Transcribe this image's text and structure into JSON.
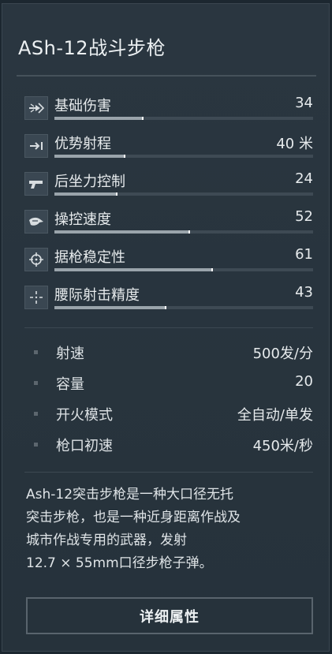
{
  "weapon": {
    "name": "ASh-12战斗步枪"
  },
  "stats": [
    {
      "label": "基础伤害",
      "value": "34",
      "level": 0.34,
      "icon": "damage-icon"
    },
    {
      "label": "优势射程",
      "value": "40 米",
      "level": 0.27,
      "icon": "range-arrow-icon"
    },
    {
      "label": "后坐力控制",
      "value": "24",
      "level": 0.24,
      "icon": "recoil-pistol-icon"
    },
    {
      "label": "操控速度",
      "value": "52",
      "level": 0.52,
      "icon": "handling-hand-icon"
    },
    {
      "label": "据枪稳定性",
      "value": "61",
      "level": 0.61,
      "icon": "stability-crosshair-icon"
    },
    {
      "label": "腰际射击精度",
      "value": "43",
      "level": 0.43,
      "icon": "hipfire-crosshair-icon"
    }
  ],
  "specs": [
    {
      "label": "射速",
      "value": "500发/分"
    },
    {
      "label": "容量",
      "value": "20"
    },
    {
      "label": "开火模式",
      "value": "全自动/单发"
    },
    {
      "label": "枪口初速",
      "value": "450米/秒"
    }
  ],
  "description": {
    "lines": [
      "Ash-12突击步枪是一种大口径无托",
      "突击步枪，也是一种近身距离作战及",
      "城市作战专用的武器，发射",
      "12.7 × 55mm口径步枪子弹。"
    ]
  },
  "button": {
    "label": "详细属性"
  }
}
